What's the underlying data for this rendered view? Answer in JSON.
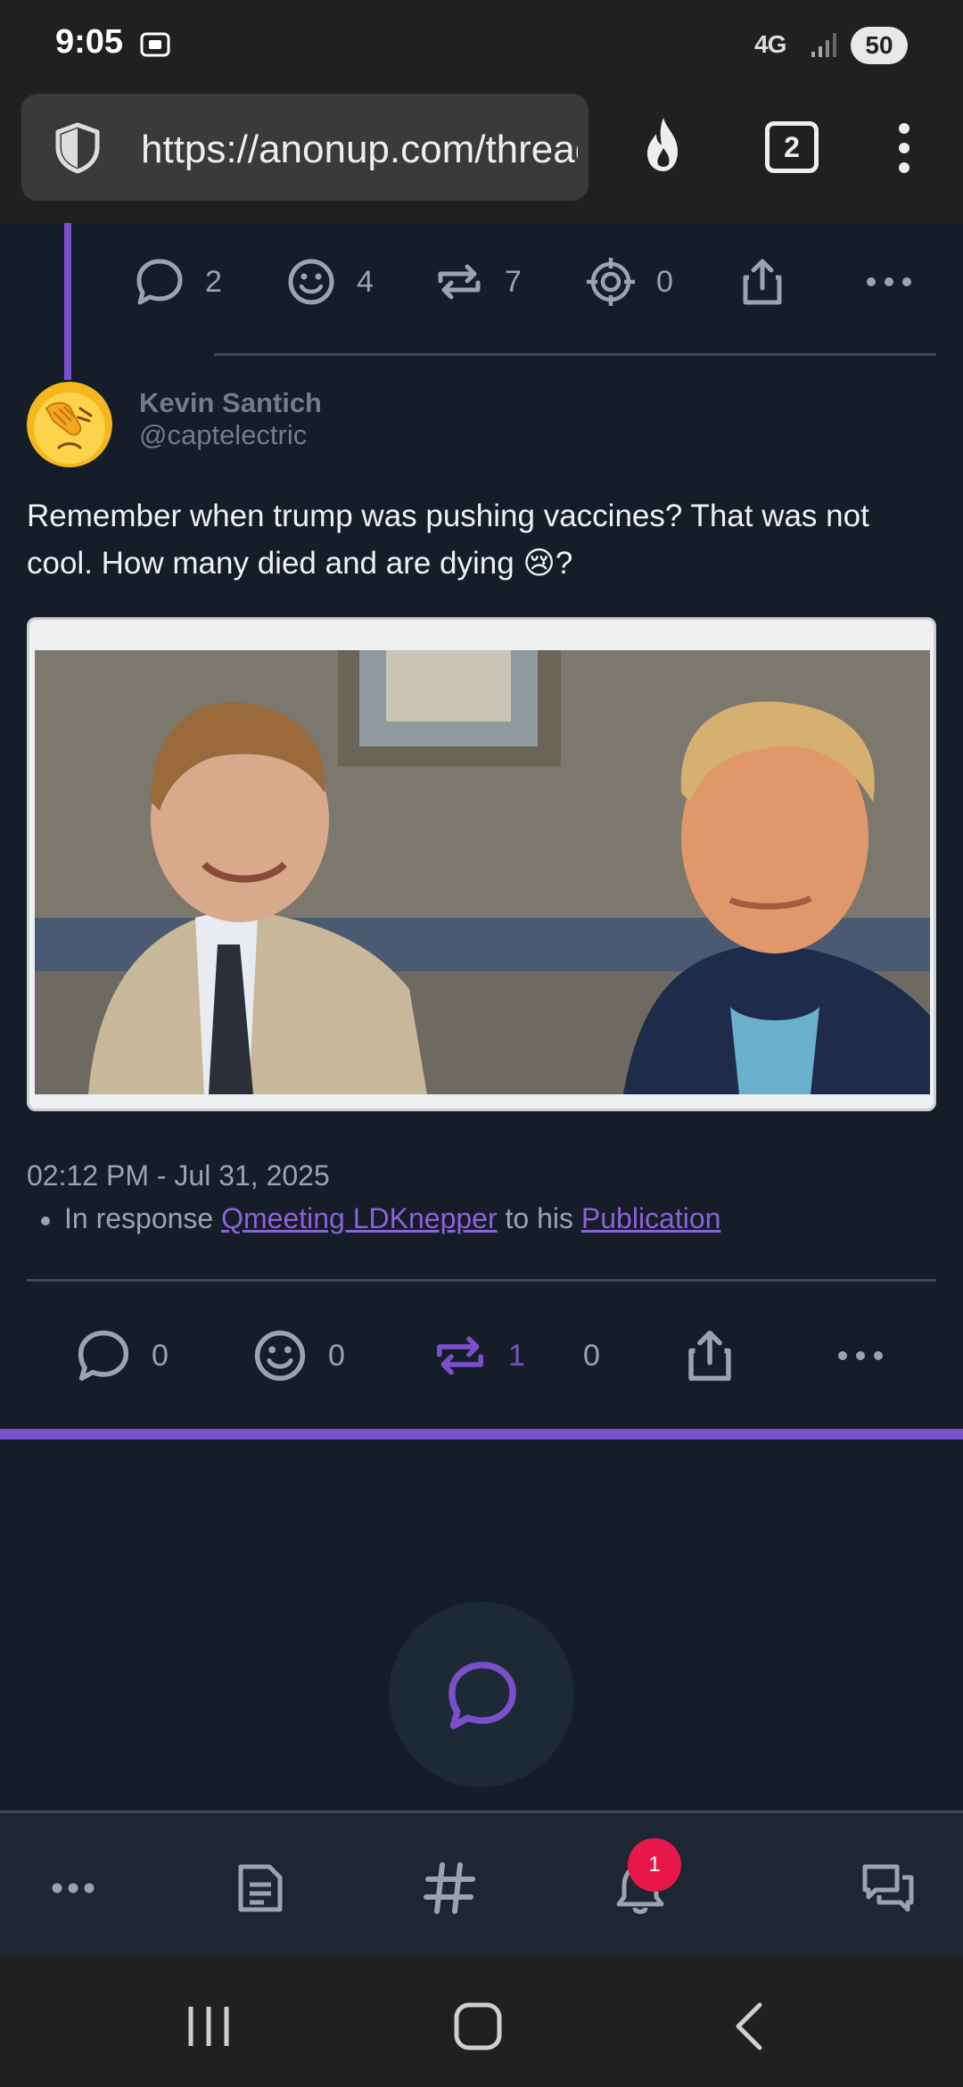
{
  "status_bar": {
    "time": "9:05",
    "network": "4G",
    "battery": "50"
  },
  "browser": {
    "url": "https://anonup.com/thread",
    "tab_count": "2"
  },
  "prev_post_actions": {
    "comments": "2",
    "reactions": "4",
    "reposts": "7",
    "targets": "0"
  },
  "post": {
    "author_name": "Kevin Santich",
    "author_handle": "@captelectric",
    "text": "Remember when trump was pushing vaccines? That was not cool. How many died and are dying 😢?",
    "timestamp": "02:12 PM - Jul 31, 2025",
    "response_prefix": "In response",
    "response_user": "Qmeeting LDKnepper",
    "response_middle": "to his",
    "response_link": "Publication",
    "actions": {
      "comments": "0",
      "reactions": "0",
      "reposts": "1",
      "targets": "0"
    }
  },
  "app_nav": {
    "notification_count": "1"
  },
  "colors": {
    "background": "#141d28",
    "accent": "#7a4fc9",
    "badge": "#e8174a",
    "muted_text": "#9aa4b0"
  }
}
